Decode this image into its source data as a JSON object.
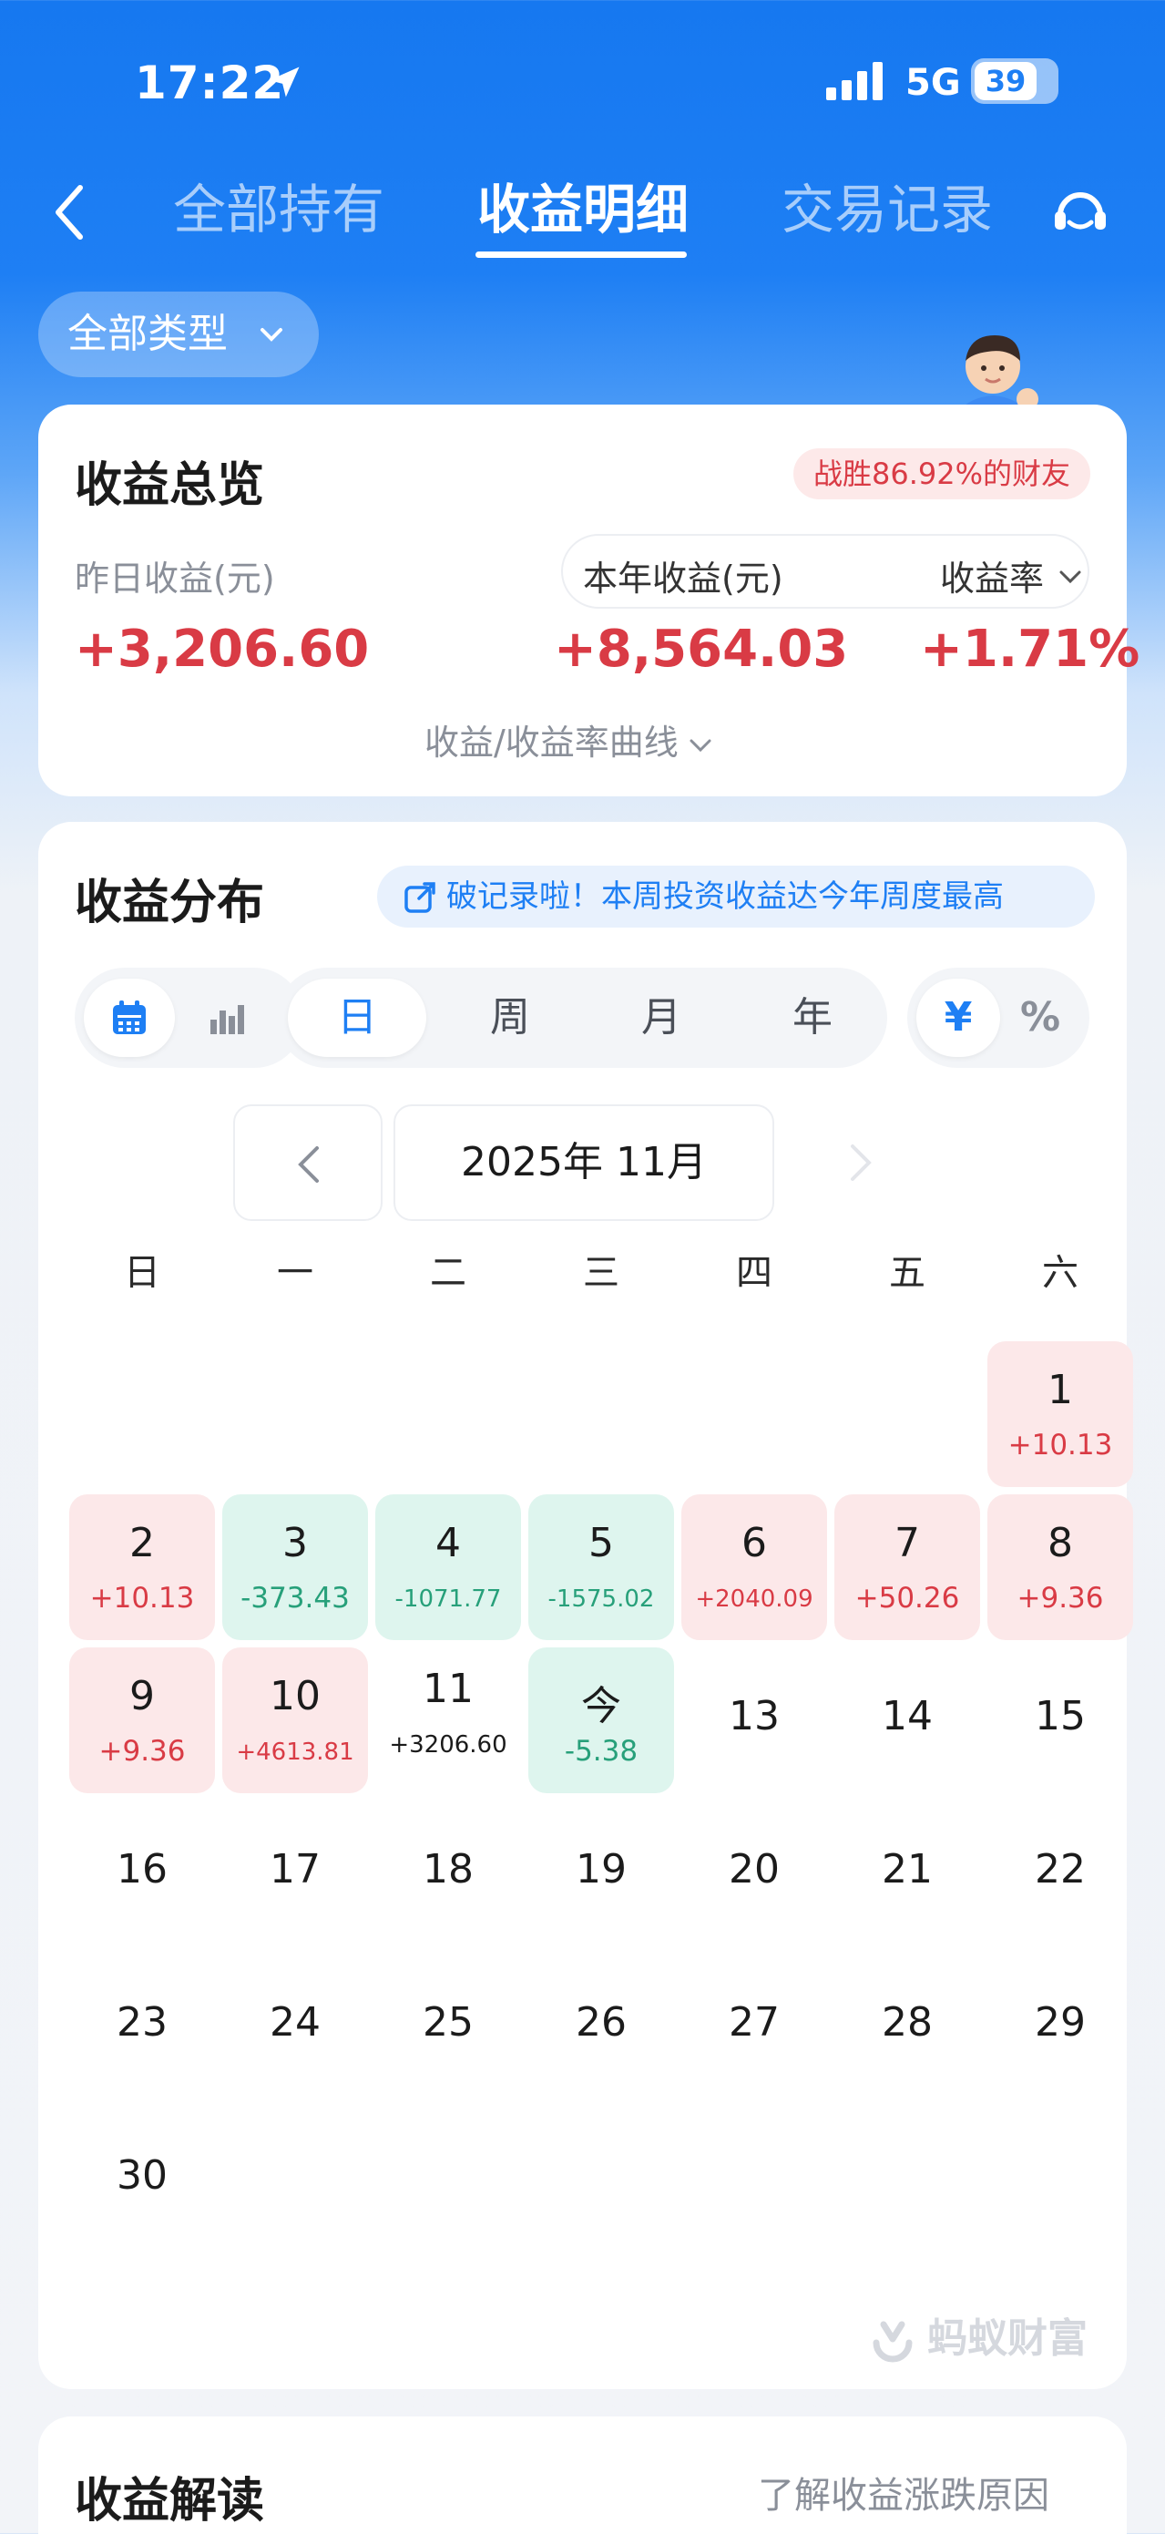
{
  "status_bar": {
    "time": "17:22",
    "network": "5G",
    "battery": "39"
  },
  "nav": {
    "tabs": [
      {
        "label": "全部持有",
        "active": false
      },
      {
        "label": "收益明细",
        "active": true
      },
      {
        "label": "交易记录",
        "active": false
      }
    ]
  },
  "filter": {
    "label": "全部类型"
  },
  "overview": {
    "title": "收益总览",
    "beat_badge": "战胜86.92%的财友",
    "yesterday_label": "昨日收益(元)",
    "yesterday_value": "+3,206.60",
    "year_label": "本年收益(元)",
    "year_value": "+8,564.03",
    "rate_label": "收益率",
    "rate_value": "+1.71%",
    "curve_toggle": "收益/收益率曲线"
  },
  "distribution": {
    "title": "收益分布",
    "record_badge": "破记录啦！本周投资收益达今年周度最高",
    "periods": [
      "日",
      "周",
      "月",
      "年"
    ],
    "active_period": "日",
    "units": [
      "¥",
      "%"
    ],
    "active_unit": "¥",
    "month": "2025年 11月",
    "weekdays": [
      "日",
      "一",
      "二",
      "三",
      "四",
      "五",
      "六"
    ],
    "cells": [
      {
        "day": "1",
        "value": "+10.13",
        "status": "red"
      },
      {
        "day": "2",
        "value": "+10.13",
        "status": "red"
      },
      {
        "day": "3",
        "value": "-373.43",
        "status": "green"
      },
      {
        "day": "4",
        "value": "-1071.77",
        "status": "green"
      },
      {
        "day": "5",
        "value": "-1575.02",
        "status": "green"
      },
      {
        "day": "6",
        "value": "+2040.09",
        "status": "red"
      },
      {
        "day": "7",
        "value": "+50.26",
        "status": "red"
      },
      {
        "day": "8",
        "value": "+9.36",
        "status": "red"
      },
      {
        "day": "9",
        "value": "+9.36",
        "status": "red"
      },
      {
        "day": "10",
        "value": "+4613.81",
        "status": "red"
      },
      {
        "day": "11",
        "value": "+3206.60",
        "status": "selected"
      },
      {
        "day": "今",
        "value": "-5.38",
        "status": "green"
      },
      {
        "day": "13",
        "value": "",
        "status": "plain"
      },
      {
        "day": "14",
        "value": "",
        "status": "plain"
      },
      {
        "day": "15",
        "value": "",
        "status": "plain"
      },
      {
        "day": "16",
        "value": "",
        "status": "plain"
      },
      {
        "day": "17",
        "value": "",
        "status": "plain"
      },
      {
        "day": "18",
        "value": "",
        "status": "plain"
      },
      {
        "day": "19",
        "value": "",
        "status": "plain"
      },
      {
        "day": "20",
        "value": "",
        "status": "plain"
      },
      {
        "day": "21",
        "value": "",
        "status": "plain"
      },
      {
        "day": "22",
        "value": "",
        "status": "plain"
      },
      {
        "day": "23",
        "value": "",
        "status": "plain"
      },
      {
        "day": "24",
        "value": "",
        "status": "plain"
      },
      {
        "day": "25",
        "value": "",
        "status": "plain"
      },
      {
        "day": "26",
        "value": "",
        "status": "plain"
      },
      {
        "day": "27",
        "value": "",
        "status": "plain"
      },
      {
        "day": "28",
        "value": "",
        "status": "plain"
      },
      {
        "day": "29",
        "value": "",
        "status": "plain"
      },
      {
        "day": "30",
        "value": "",
        "status": "plain"
      }
    ],
    "watermark": "蚂蚁财富"
  },
  "explain": {
    "title": "收益解读",
    "link": "了解收益涨跌原因"
  },
  "colors": {
    "brand_blue": "#1e7ff4",
    "gain_red": "#d93b45",
    "loss_green": "#27a07a"
  },
  "icons": [
    "location-arrow-icon",
    "signal-icon",
    "battery-icon",
    "back-icon",
    "customer-service-icon",
    "chevron-down-icon",
    "external-link-icon",
    "calendar-icon",
    "bar-chart-icon",
    "chevron-left-icon",
    "chevron-right-icon",
    "ant-fortune-logo-icon"
  ]
}
